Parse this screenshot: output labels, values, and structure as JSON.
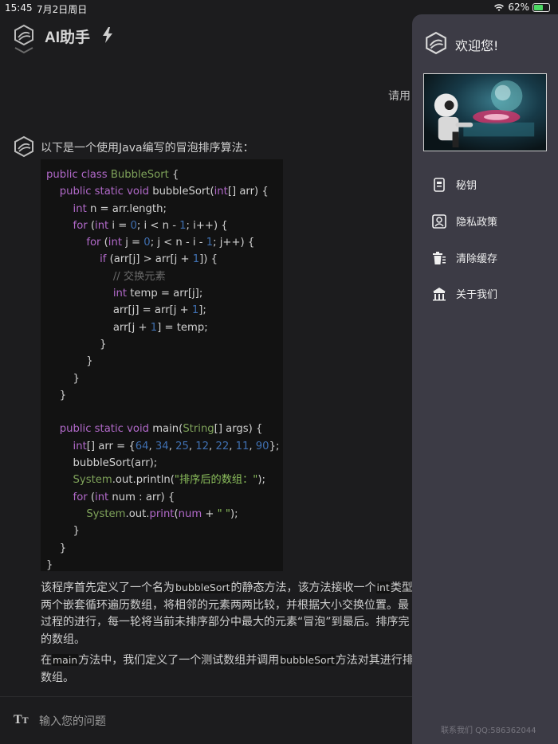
{
  "status": {
    "time": "15:45",
    "date": "7月2日周日",
    "battery": "62%",
    "battery_level": 0.62
  },
  "header": {
    "title": "AI助手"
  },
  "user_message": {
    "text": "请用"
  },
  "bot_message": {
    "intro": "以下是一个使用Java编写的冒泡排序算法：",
    "code_lines": [
      "public class BubbleSort {",
      "    public static void bubbleSort(int[] arr) {",
      "        int n = arr.length;",
      "        for (int i = 0; i < n - 1; i++) {",
      "            for (int j = 0; j < n - i - 1; j++) {",
      "                if (arr[j] > arr[j + 1]) {",
      "                    // 交换元素",
      "                    int temp = arr[j];",
      "                    arr[j] = arr[j + 1];",
      "                    arr[j + 1] = temp;",
      "                }",
      "            }",
      "        }",
      "    }",
      "",
      "    public static void main(String[] args) {",
      "        int[] arr = {64, 34, 25, 12, 22, 11, 90};",
      "        bubbleSort(arr);",
      "        System.out.println(\"排序后的数组：\");",
      "        for (int num : arr) {",
      "            System.out.print(num + \" \");",
      "        }",
      "    }",
      "}"
    ],
    "para1": {
      "l1a": "该程序首先定义了一个名为",
      "l1code": "bubbleSort",
      "l1b": "的静态方法，该方法接收一个",
      "l1code2": "int",
      "l1c": "类型的",
      "l2": "两个嵌套循环遍历数组，将相邻的元素两两比较，并根据大小交换位置。最",
      "l3": "过程的进行，每一轮将当前未排序部分中最大的元素“冒泡”到最后。排序完",
      "l4": "的数组。"
    },
    "para2": {
      "l1a": "在",
      "l1code": "main",
      "l1b": "方法中，我们定义了一个测试数组并调用",
      "l1code2": "bubbleSort",
      "l1c": "方法对其进行排序",
      "l2": "数组。"
    }
  },
  "input": {
    "placeholder": "输入您的问题"
  },
  "drawer": {
    "welcome": "欢迎您!",
    "menu": [
      {
        "label": "秘钥",
        "icon": "key-card-icon"
      },
      {
        "label": "隐私政策",
        "icon": "privacy-icon"
      },
      {
        "label": "清除缓存",
        "icon": "trash-icon"
      },
      {
        "label": "关于我们",
        "icon": "building-icon"
      }
    ],
    "contact": "联系我们 QQ:586362044"
  }
}
